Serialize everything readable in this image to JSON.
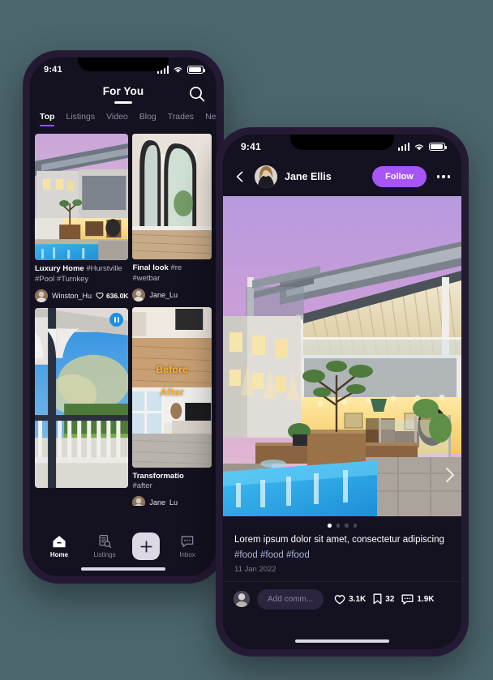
{
  "phone_feed": {
    "status": {
      "time": "9:41",
      "signal": "signal-bars",
      "wifi": "wifi-icon",
      "battery": "battery-icon"
    },
    "header": {
      "title": "For You",
      "search": "search-icon"
    },
    "tabs": [
      {
        "label": "Top",
        "active": true
      },
      {
        "label": "Listings",
        "active": false
      },
      {
        "label": "Video",
        "active": false
      },
      {
        "label": "Blog",
        "active": false
      },
      {
        "label": "Trades",
        "active": false
      },
      {
        "label": "News",
        "active": false
      }
    ],
    "cards": [
      {
        "id": "card-luxury-home",
        "title": "Luxury Home",
        "tags": "#Hurstville",
        "tags2": "#Pool #Turnkey",
        "user": "Winston_Hu",
        "likes": "636.0K",
        "has_pause": false
      },
      {
        "id": "card-final-look",
        "title": "Final look",
        "tags": "#re",
        "tags2": "#wetbar",
        "user": "Jane_Lu",
        "likes": "",
        "has_pause": false
      },
      {
        "id": "card-verandah",
        "title": "",
        "tags": "",
        "tags2": "",
        "user": "",
        "likes": "",
        "has_pause": true
      },
      {
        "id": "card-transformation",
        "title": "Transformatio",
        "tags": "",
        "tags2": "#after",
        "user": "Jane_Lu",
        "likes": "",
        "has_pause": false,
        "overlay_before": "Before",
        "overlay_after": "After"
      }
    ],
    "bottom_nav": [
      {
        "label": "Home",
        "icon": "home-icon",
        "active": true
      },
      {
        "label": "Listings",
        "icon": "listings-search-icon",
        "active": false
      },
      {
        "label": "",
        "icon": "plus-icon",
        "active": false
      },
      {
        "label": "Inbox",
        "icon": "chat-bubble-icon",
        "active": false
      }
    ]
  },
  "phone_post": {
    "status": {
      "time": "9:41",
      "signal": "signal-bars",
      "wifi": "wifi-icon",
      "battery": "battery-icon"
    },
    "header": {
      "back": "back-chevron-icon",
      "author": "Jane Ellis",
      "follow_label": "Follow",
      "more": "more-options-icon"
    },
    "gallery": {
      "total_dots": 4,
      "active_index": 0
    },
    "post": {
      "caption": "Lorem ipsum dolor sit amet, consectetur adipiscing",
      "hashtags": "#food #food #food",
      "date": "11 Jan 2022"
    },
    "actions": {
      "comment_placeholder": "Add comm...",
      "likes": "3.1K",
      "saves": "32",
      "comments": "1.9K"
    }
  },
  "colors": {
    "page_background": "#4c666e",
    "phone_frame": "#241a33",
    "screen_background": "#141120",
    "accent_purple": "#8b5cf6",
    "follow_purple": "#a855f7",
    "pause_blue": "#1a8fe8",
    "muted_text": "#8e8aa0",
    "hashtag_blue": "#a9b5d9"
  }
}
